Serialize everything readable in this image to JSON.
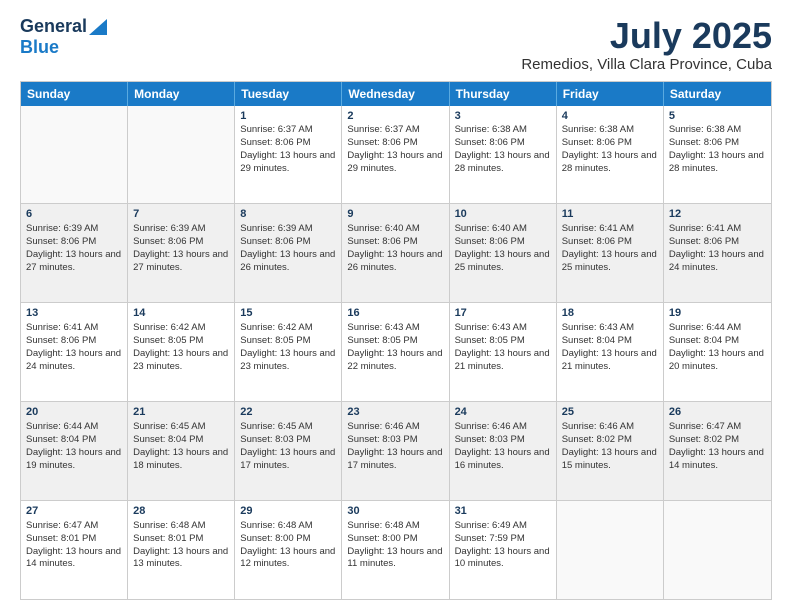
{
  "logo": {
    "general": "General",
    "blue": "Blue"
  },
  "header": {
    "month": "July 2025",
    "location": "Remedios, Villa Clara Province, Cuba"
  },
  "days_of_week": [
    "Sunday",
    "Monday",
    "Tuesday",
    "Wednesday",
    "Thursday",
    "Friday",
    "Saturday"
  ],
  "weeks": [
    [
      {
        "day": "",
        "sunrise": "",
        "sunset": "",
        "daylight": ""
      },
      {
        "day": "",
        "sunrise": "",
        "sunset": "",
        "daylight": ""
      },
      {
        "day": "1",
        "sunrise": "Sunrise: 6:37 AM",
        "sunset": "Sunset: 8:06 PM",
        "daylight": "Daylight: 13 hours and 29 minutes."
      },
      {
        "day": "2",
        "sunrise": "Sunrise: 6:37 AM",
        "sunset": "Sunset: 8:06 PM",
        "daylight": "Daylight: 13 hours and 29 minutes."
      },
      {
        "day": "3",
        "sunrise": "Sunrise: 6:38 AM",
        "sunset": "Sunset: 8:06 PM",
        "daylight": "Daylight: 13 hours and 28 minutes."
      },
      {
        "day": "4",
        "sunrise": "Sunrise: 6:38 AM",
        "sunset": "Sunset: 8:06 PM",
        "daylight": "Daylight: 13 hours and 28 minutes."
      },
      {
        "day": "5",
        "sunrise": "Sunrise: 6:38 AM",
        "sunset": "Sunset: 8:06 PM",
        "daylight": "Daylight: 13 hours and 28 minutes."
      }
    ],
    [
      {
        "day": "6",
        "sunrise": "Sunrise: 6:39 AM",
        "sunset": "Sunset: 8:06 PM",
        "daylight": "Daylight: 13 hours and 27 minutes."
      },
      {
        "day": "7",
        "sunrise": "Sunrise: 6:39 AM",
        "sunset": "Sunset: 8:06 PM",
        "daylight": "Daylight: 13 hours and 27 minutes."
      },
      {
        "day": "8",
        "sunrise": "Sunrise: 6:39 AM",
        "sunset": "Sunset: 8:06 PM",
        "daylight": "Daylight: 13 hours and 26 minutes."
      },
      {
        "day": "9",
        "sunrise": "Sunrise: 6:40 AM",
        "sunset": "Sunset: 8:06 PM",
        "daylight": "Daylight: 13 hours and 26 minutes."
      },
      {
        "day": "10",
        "sunrise": "Sunrise: 6:40 AM",
        "sunset": "Sunset: 8:06 PM",
        "daylight": "Daylight: 13 hours and 25 minutes."
      },
      {
        "day": "11",
        "sunrise": "Sunrise: 6:41 AM",
        "sunset": "Sunset: 8:06 PM",
        "daylight": "Daylight: 13 hours and 25 minutes."
      },
      {
        "day": "12",
        "sunrise": "Sunrise: 6:41 AM",
        "sunset": "Sunset: 8:06 PM",
        "daylight": "Daylight: 13 hours and 24 minutes."
      }
    ],
    [
      {
        "day": "13",
        "sunrise": "Sunrise: 6:41 AM",
        "sunset": "Sunset: 8:06 PM",
        "daylight": "Daylight: 13 hours and 24 minutes."
      },
      {
        "day": "14",
        "sunrise": "Sunrise: 6:42 AM",
        "sunset": "Sunset: 8:05 PM",
        "daylight": "Daylight: 13 hours and 23 minutes."
      },
      {
        "day": "15",
        "sunrise": "Sunrise: 6:42 AM",
        "sunset": "Sunset: 8:05 PM",
        "daylight": "Daylight: 13 hours and 23 minutes."
      },
      {
        "day": "16",
        "sunrise": "Sunrise: 6:43 AM",
        "sunset": "Sunset: 8:05 PM",
        "daylight": "Daylight: 13 hours and 22 minutes."
      },
      {
        "day": "17",
        "sunrise": "Sunrise: 6:43 AM",
        "sunset": "Sunset: 8:05 PM",
        "daylight": "Daylight: 13 hours and 21 minutes."
      },
      {
        "day": "18",
        "sunrise": "Sunrise: 6:43 AM",
        "sunset": "Sunset: 8:04 PM",
        "daylight": "Daylight: 13 hours and 21 minutes."
      },
      {
        "day": "19",
        "sunrise": "Sunrise: 6:44 AM",
        "sunset": "Sunset: 8:04 PM",
        "daylight": "Daylight: 13 hours and 20 minutes."
      }
    ],
    [
      {
        "day": "20",
        "sunrise": "Sunrise: 6:44 AM",
        "sunset": "Sunset: 8:04 PM",
        "daylight": "Daylight: 13 hours and 19 minutes."
      },
      {
        "day": "21",
        "sunrise": "Sunrise: 6:45 AM",
        "sunset": "Sunset: 8:04 PM",
        "daylight": "Daylight: 13 hours and 18 minutes."
      },
      {
        "day": "22",
        "sunrise": "Sunrise: 6:45 AM",
        "sunset": "Sunset: 8:03 PM",
        "daylight": "Daylight: 13 hours and 17 minutes."
      },
      {
        "day": "23",
        "sunrise": "Sunrise: 6:46 AM",
        "sunset": "Sunset: 8:03 PM",
        "daylight": "Daylight: 13 hours and 17 minutes."
      },
      {
        "day": "24",
        "sunrise": "Sunrise: 6:46 AM",
        "sunset": "Sunset: 8:03 PM",
        "daylight": "Daylight: 13 hours and 16 minutes."
      },
      {
        "day": "25",
        "sunrise": "Sunrise: 6:46 AM",
        "sunset": "Sunset: 8:02 PM",
        "daylight": "Daylight: 13 hours and 15 minutes."
      },
      {
        "day": "26",
        "sunrise": "Sunrise: 6:47 AM",
        "sunset": "Sunset: 8:02 PM",
        "daylight": "Daylight: 13 hours and 14 minutes."
      }
    ],
    [
      {
        "day": "27",
        "sunrise": "Sunrise: 6:47 AM",
        "sunset": "Sunset: 8:01 PM",
        "daylight": "Daylight: 13 hours and 14 minutes."
      },
      {
        "day": "28",
        "sunrise": "Sunrise: 6:48 AM",
        "sunset": "Sunset: 8:01 PM",
        "daylight": "Daylight: 13 hours and 13 minutes."
      },
      {
        "day": "29",
        "sunrise": "Sunrise: 6:48 AM",
        "sunset": "Sunset: 8:00 PM",
        "daylight": "Daylight: 13 hours and 12 minutes."
      },
      {
        "day": "30",
        "sunrise": "Sunrise: 6:48 AM",
        "sunset": "Sunset: 8:00 PM",
        "daylight": "Daylight: 13 hours and 11 minutes."
      },
      {
        "day": "31",
        "sunrise": "Sunrise: 6:49 AM",
        "sunset": "Sunset: 7:59 PM",
        "daylight": "Daylight: 13 hours and 10 minutes."
      },
      {
        "day": "",
        "sunrise": "",
        "sunset": "",
        "daylight": ""
      },
      {
        "day": "",
        "sunrise": "",
        "sunset": "",
        "daylight": ""
      }
    ]
  ]
}
